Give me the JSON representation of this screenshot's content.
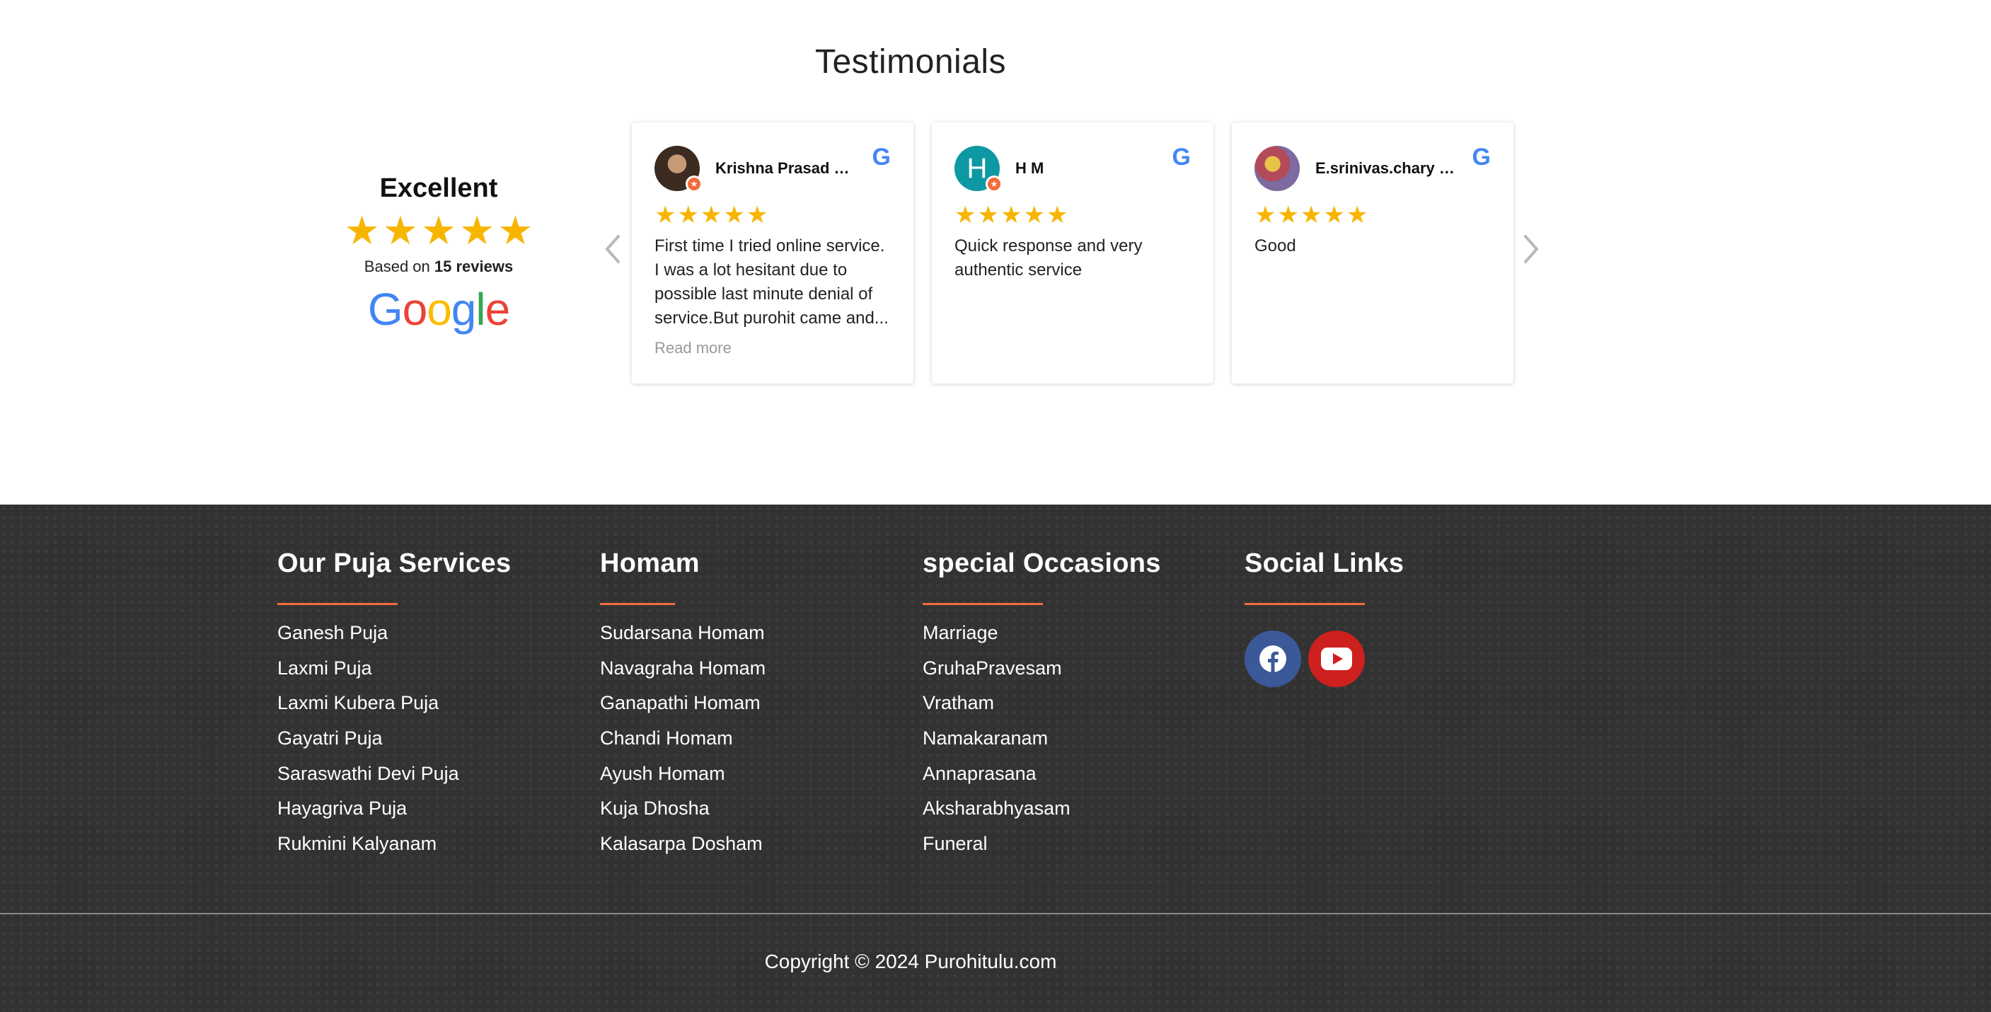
{
  "testimonials": {
    "title": "Testimonials",
    "summary": {
      "rating_word": "Excellent",
      "stars": 5,
      "based_prefix": "Based on",
      "reviews_count": "15 reviews",
      "provider": "Google"
    },
    "reviews": [
      {
        "name": "Krishna Prasad M...",
        "stars": 5,
        "text": "First time I tried online service. I was a lot hesitant due to possible last minute denial of service.But purohit came and...",
        "read_more": "Read more"
      },
      {
        "name": "H M",
        "avatar_letter": "H",
        "stars": 5,
        "text": "Quick response and very authentic service"
      },
      {
        "name": "E.srinivas.chary E....",
        "stars": 5,
        "text": "Good"
      }
    ]
  },
  "footer": {
    "puja": {
      "title": "Our Puja Services",
      "items": [
        "Ganesh Puja",
        "Laxmi Puja",
        "Laxmi Kubera Puja",
        "Gayatri Puja",
        "Saraswathi Devi Puja",
        "Hayagriva Puja",
        "Rukmini Kalyanam"
      ]
    },
    "homam": {
      "title": "Homam",
      "items": [
        "Sudarsana Homam",
        "Navagraha Homam",
        "Ganapathi Homam",
        "Chandi Homam",
        "Ayush Homam",
        "Kuja Dhosha",
        "Kalasarpa Dosham"
      ]
    },
    "occasions": {
      "title": "special Occasions",
      "items": [
        "Marriage",
        "GruhaPravesam",
        "Vratham",
        "Namakaranam",
        "Annaprasana",
        "Aksharabhyasam",
        "Funeral"
      ]
    },
    "social": {
      "title": "Social Links",
      "links": [
        {
          "icon": "facebook-icon",
          "color": "#3b5998"
        },
        {
          "icon": "youtube-icon",
          "color": "#cd201f"
        }
      ]
    },
    "copyright": "Copyright © 2024 Purohitulu.com"
  },
  "colors": {
    "accent": "#f26b3a",
    "star": "#f7b500",
    "footer_bg": "#323232"
  }
}
